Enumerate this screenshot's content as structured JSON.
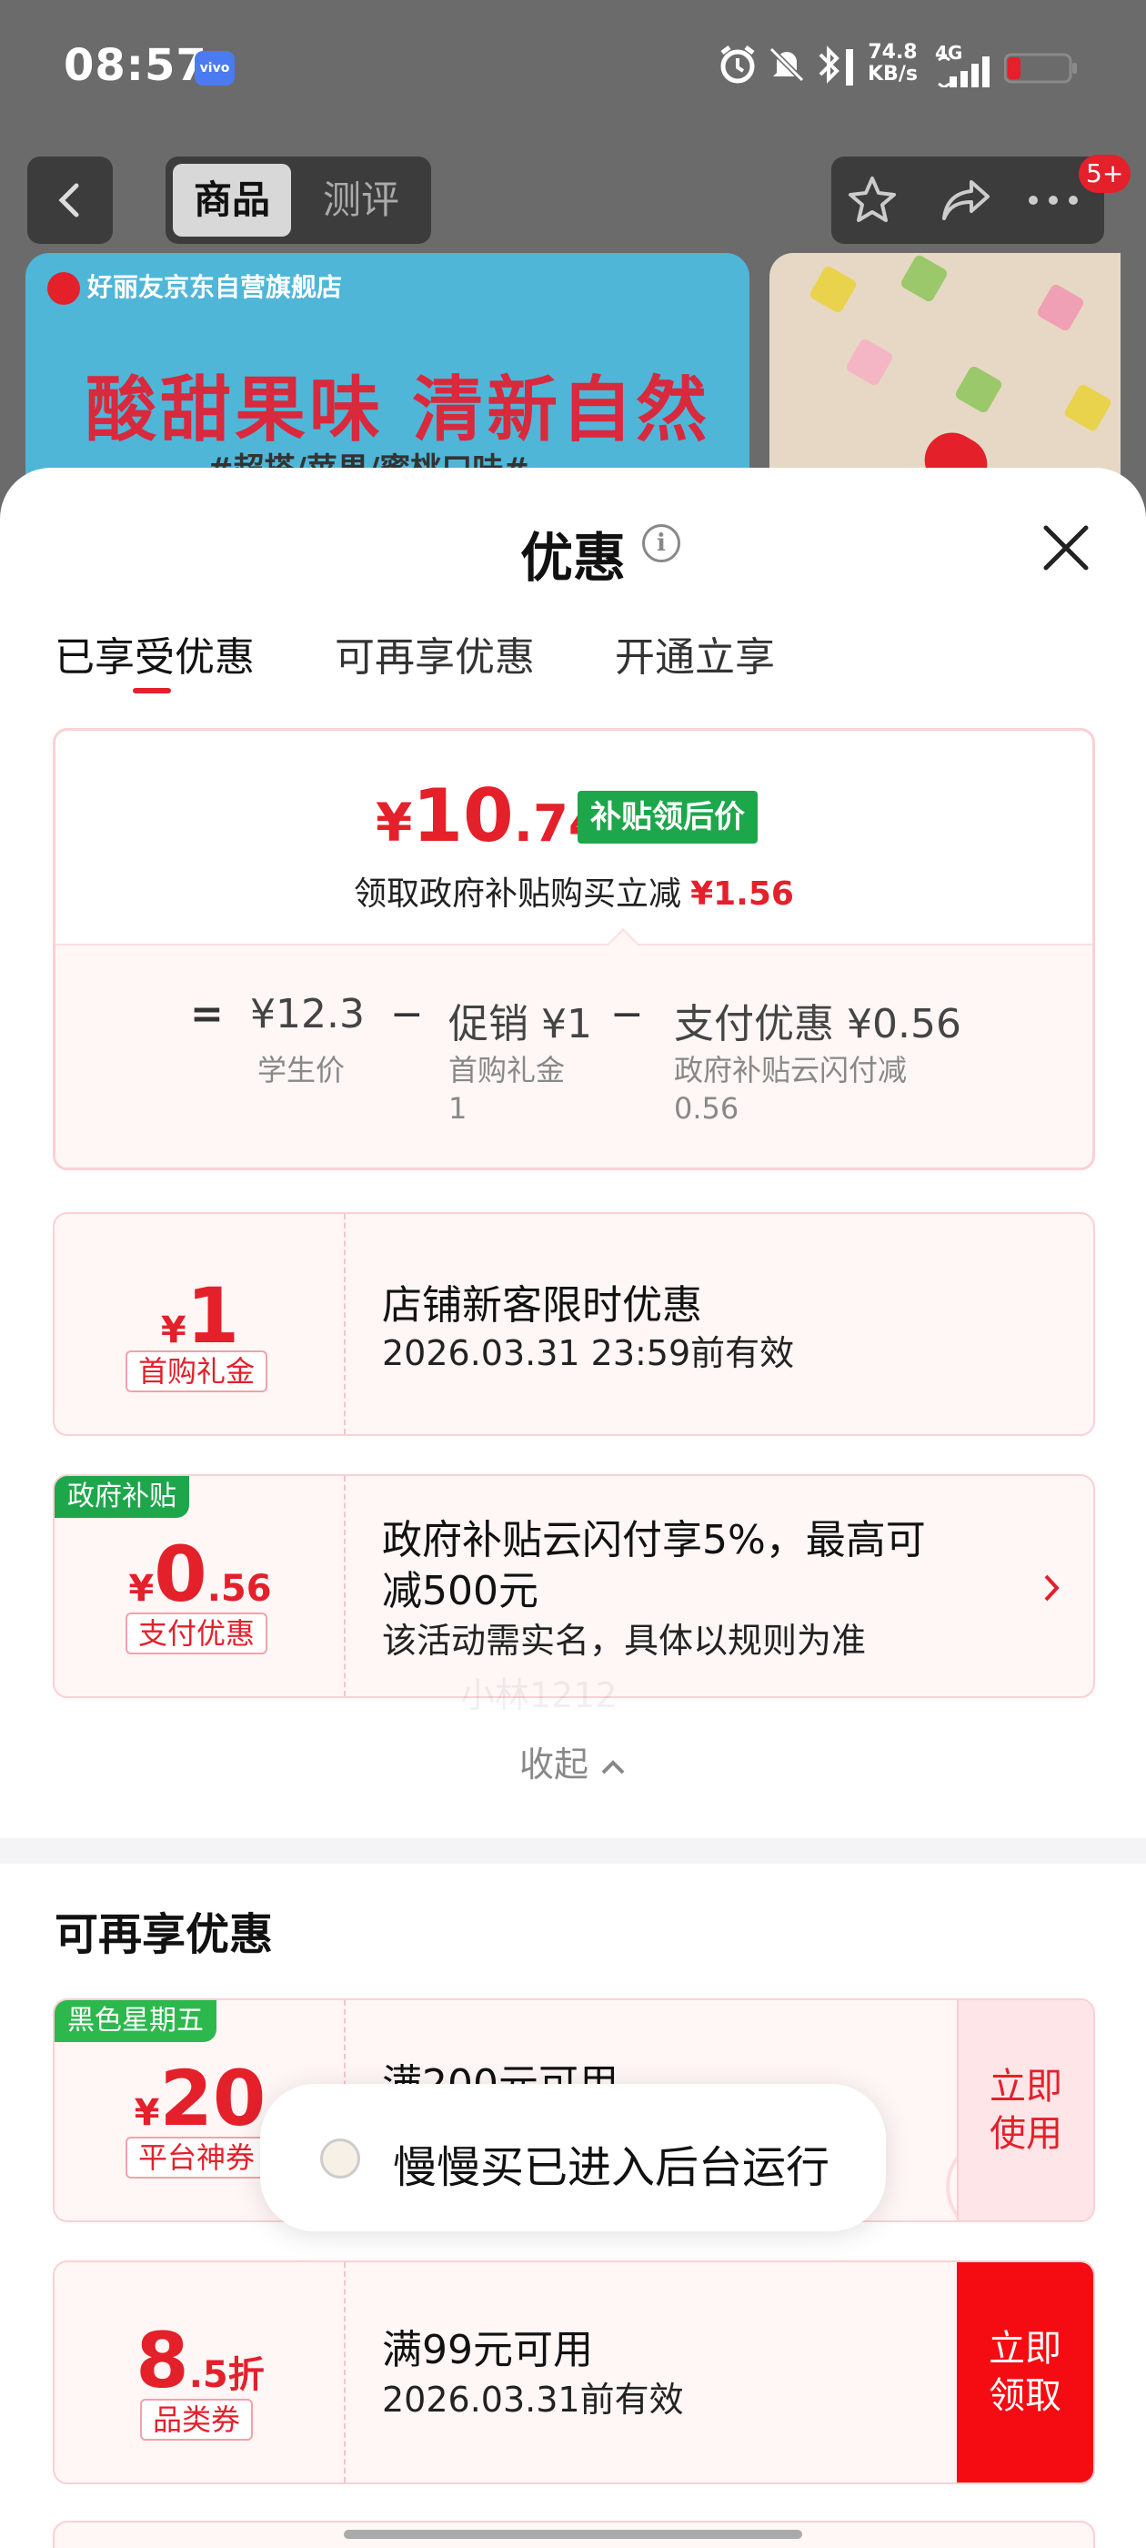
{
  "status_bar": {
    "time": "08:57",
    "brand": "vivo",
    "speed_value": "74.8",
    "speed_unit": "KB/s",
    "network": "4G",
    "icons": [
      "alarm-icon",
      "mute-icon",
      "bluetooth-icon",
      "signal-icon",
      "battery-icon"
    ]
  },
  "nav": {
    "tab_product": "商品",
    "tab_review": "测评",
    "badge": "5+",
    "icons": [
      "back-icon",
      "star-icon",
      "share-icon",
      "more-icon"
    ]
  },
  "banner": {
    "store": "好丽友京东自营旗舰店",
    "slogan": "酸甜果味 清新自然",
    "flavors": "#超搭/苹果/蜜桃口味#"
  },
  "sheet": {
    "title": "优惠",
    "tabs": [
      "已享受优惠",
      "可再享优惠",
      "开通立享"
    ],
    "summary": {
      "currency": "¥",
      "price_int": "10",
      "price_dec": ".74",
      "price_tag": "补贴领后价",
      "gov_text": "领取政府补贴购买立减",
      "gov_amount": "¥1.56",
      "eq": "=",
      "minus": "−",
      "item1_value": "¥12.3",
      "item1_label": "学生价",
      "item2_value": "促销 ¥1",
      "item2_label": "首购礼金",
      "item2_sub": "1",
      "item3_value": "支付优惠 ¥0.56",
      "item3_label": "政府补贴云闪付减",
      "item3_sub": "0.56"
    },
    "watermark": "小林1212",
    "coupons_applied": [
      {
        "currency": "¥",
        "amount": "1",
        "type": "首购礼金",
        "title": "店铺新客限时优惠",
        "desc": "2026.03.31 23:59前有效"
      },
      {
        "tag": "政府补贴",
        "currency": "¥",
        "amount": "0",
        "amount_dec": ".56",
        "type": "支付优惠",
        "title_line1": "政府补贴云闪付享5%，最高可",
        "title_line2": "减500元",
        "desc": "该活动需实名，具体以规则为准"
      }
    ],
    "collapse": "收起",
    "section_title": "可再享优惠",
    "coupons_more": [
      {
        "tag": "黑色星期五",
        "currency": "¥",
        "amount": "20",
        "type": "平台神券",
        "title": "满200元可用",
        "button_line1": "立即",
        "button_line2": "使用",
        "stamp": "已领"
      },
      {
        "amount": "8",
        "amount_dec": ".5折",
        "type": "品类券",
        "title": "满99元可用",
        "desc": "2026.03.31前有效",
        "button_line1": "立即",
        "button_line2": "领取"
      }
    ]
  },
  "toast": {
    "text": "慢慢买已进入后台运行"
  },
  "colors": {
    "accent_red": "#e4202b",
    "green": "#1ea64b",
    "coupon_bg": "#fff6f6"
  }
}
